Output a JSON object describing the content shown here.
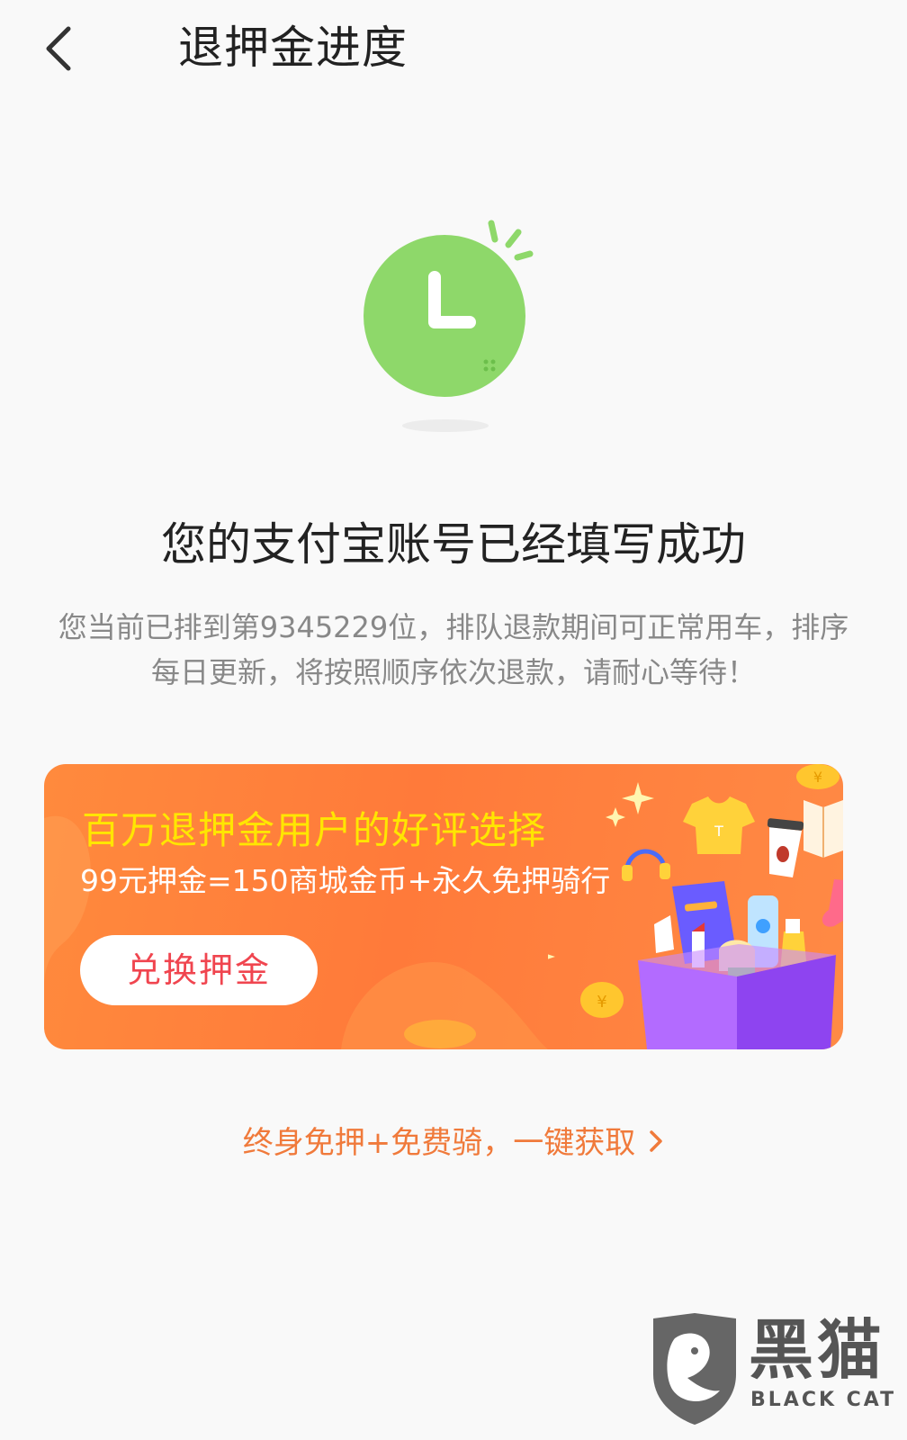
{
  "header": {
    "title": "退押金进度",
    "back_icon": "chevron-left-icon"
  },
  "status": {
    "icon": "clock-icon",
    "title": "您的支付宝账号已经填写成功",
    "description": "您当前已排到第9345229位，排队退款期间可正常用车，排序每日更新，将按照顺序依次退款，请耐心等待！"
  },
  "banner": {
    "headline": "百万退押金用户的好评选择",
    "subline": "99元押金=150商城金币+永久免押骑行",
    "button_label": "兑换押金"
  },
  "bottom_link": {
    "label": "终身免押+免费骑，一键获取",
    "icon": "chevron-right-icon"
  },
  "watermark": {
    "title_cn": "黑猫",
    "title_en": "BLACK CAT"
  },
  "colors": {
    "accent_green": "#8ed86a",
    "banner_orange": "#ff7f3c",
    "headline_yellow": "#ffe600",
    "button_text_red": "#f0454f",
    "link_orange": "#f07a3b"
  }
}
